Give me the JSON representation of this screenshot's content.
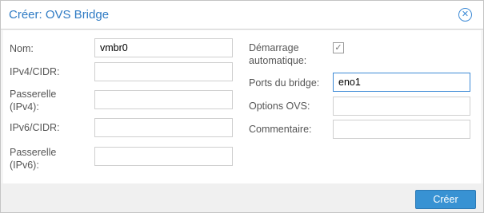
{
  "dialog": {
    "title": "Créer: OVS Bridge",
    "close_icon": "close-circle-icon"
  },
  "form": {
    "left": [
      {
        "label": "Nom:",
        "value": "vmbr0"
      },
      {
        "label": "IPv4/CIDR:",
        "value": ""
      },
      {
        "label": "Passerelle (IPv4):",
        "value": ""
      },
      {
        "label": "IPv6/CIDR:",
        "value": ""
      },
      {
        "label": "Passerelle (IPv6):",
        "value": ""
      }
    ],
    "right": {
      "autostart_label": "Démarrage automatique:",
      "autostart_checked": true,
      "ports_label": "Ports du bridge:",
      "ports_value": "eno1",
      "ovs_options_label": "Options OVS:",
      "ovs_options_value": "",
      "comment_label": "Commentaire:",
      "comment_value": ""
    }
  },
  "footer": {
    "create_label": "Créer"
  },
  "colors": {
    "accent": "#3892d3",
    "title": "#2f7bc4"
  }
}
